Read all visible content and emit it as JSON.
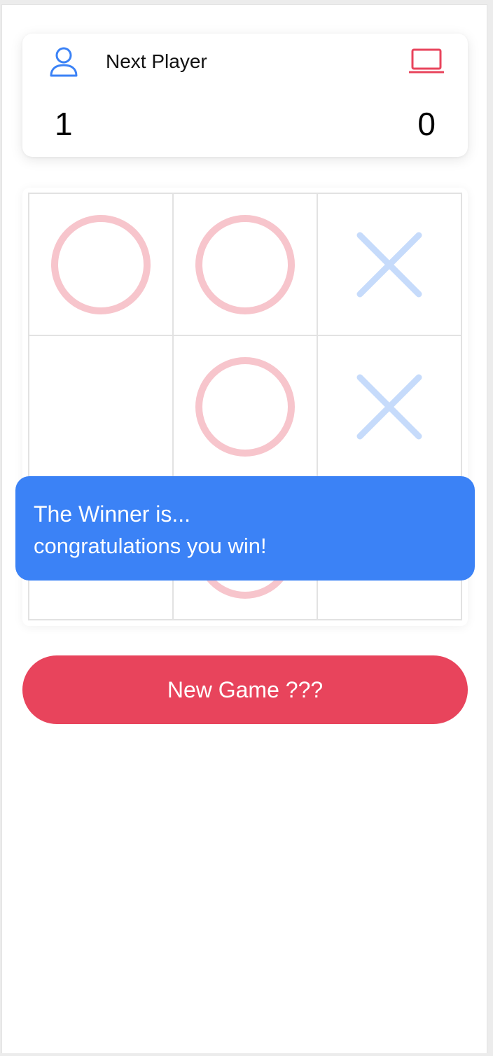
{
  "header": {
    "next_label": "Next Player",
    "player_icon": "user-icon",
    "computer_icon": "laptop-icon",
    "player_score": "1",
    "computer_score": "0"
  },
  "board": {
    "cells": [
      {
        "mark": "O"
      },
      {
        "mark": "O"
      },
      {
        "mark": "X"
      },
      {
        "mark": ""
      },
      {
        "mark": "O"
      },
      {
        "mark": "X"
      },
      {
        "mark": ""
      },
      {
        "mark": "O"
      },
      {
        "mark": ""
      }
    ]
  },
  "toast": {
    "title": "The Winner is...",
    "message": "congratulations you win!"
  },
  "actions": {
    "new_game_label": "New Game ???"
  },
  "colors": {
    "player_blue": "#3b82f6",
    "computer_red": "#e8445c",
    "o_mark": "#f7c5cc",
    "x_mark": "#c6dbfb",
    "toast_bg": "#3b82f6",
    "button_bg": "#e8445c"
  }
}
